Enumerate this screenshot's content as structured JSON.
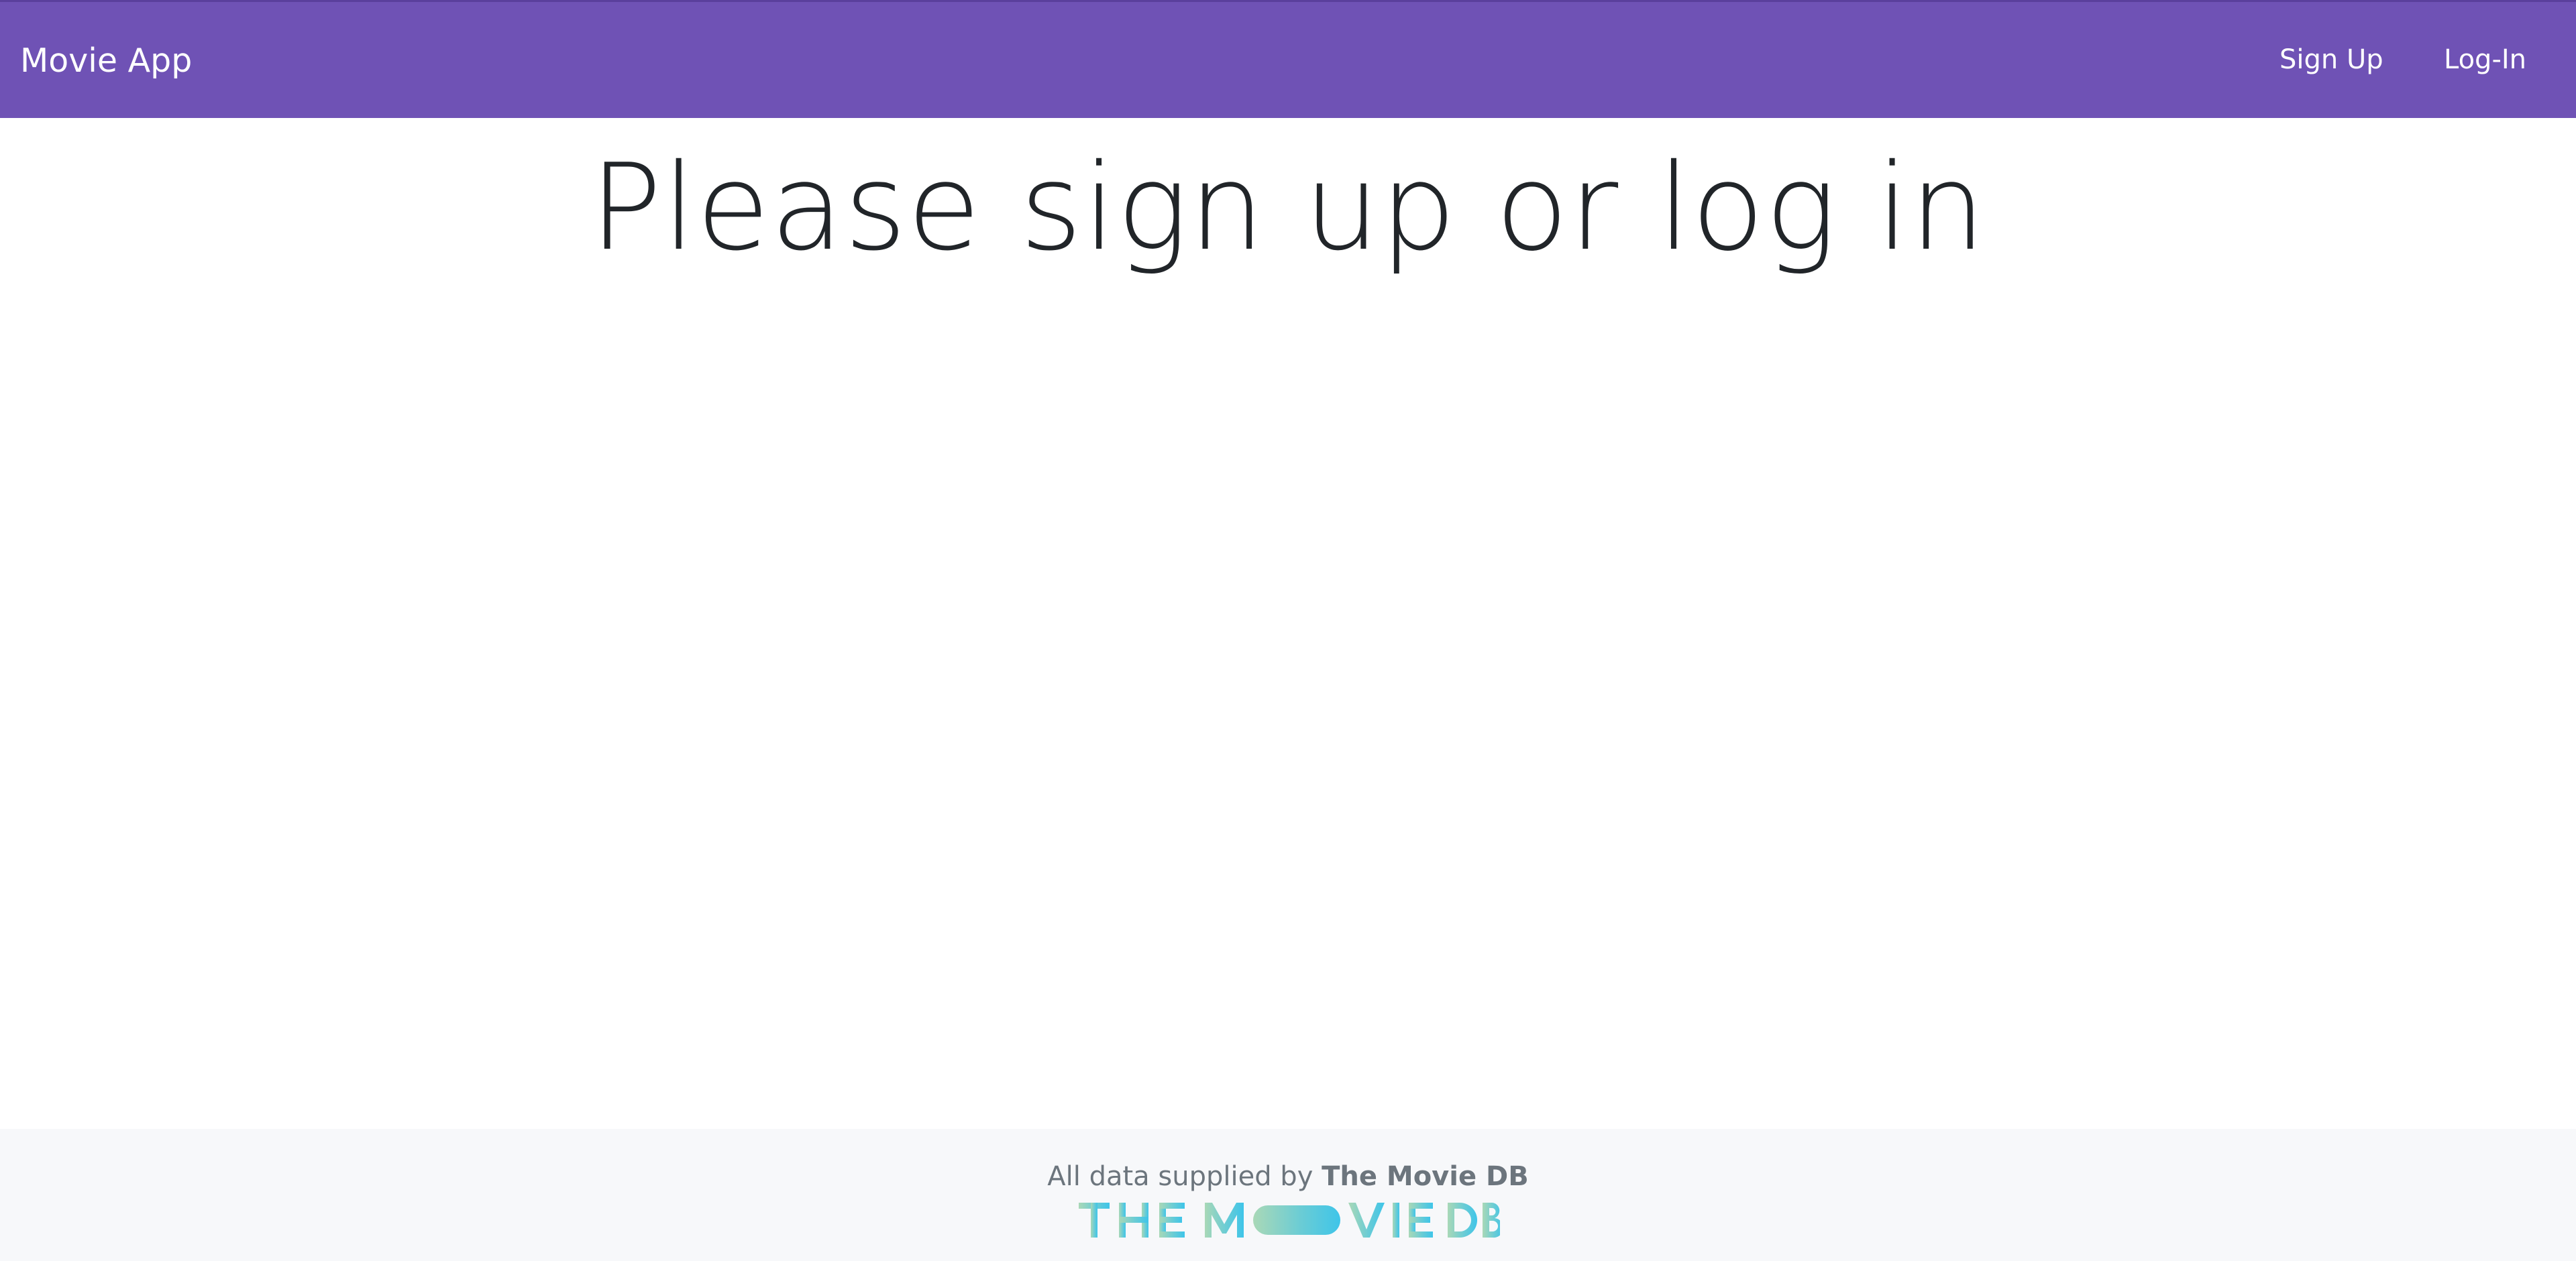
{
  "nav": {
    "brand": "Movie App",
    "links": [
      {
        "label": "Sign Up"
      },
      {
        "label": "Log-In"
      }
    ],
    "background_color": "#6f52b5"
  },
  "main": {
    "heading": "Please sign up or log in"
  },
  "footer": {
    "credit_prefix": "All data supplied by ",
    "credit_source": "The Movie DB",
    "logo_text": "THE MOVIE DB",
    "logo_gradient": [
      "#90cea1",
      "#3cbec9",
      "#00b3e5"
    ]
  }
}
